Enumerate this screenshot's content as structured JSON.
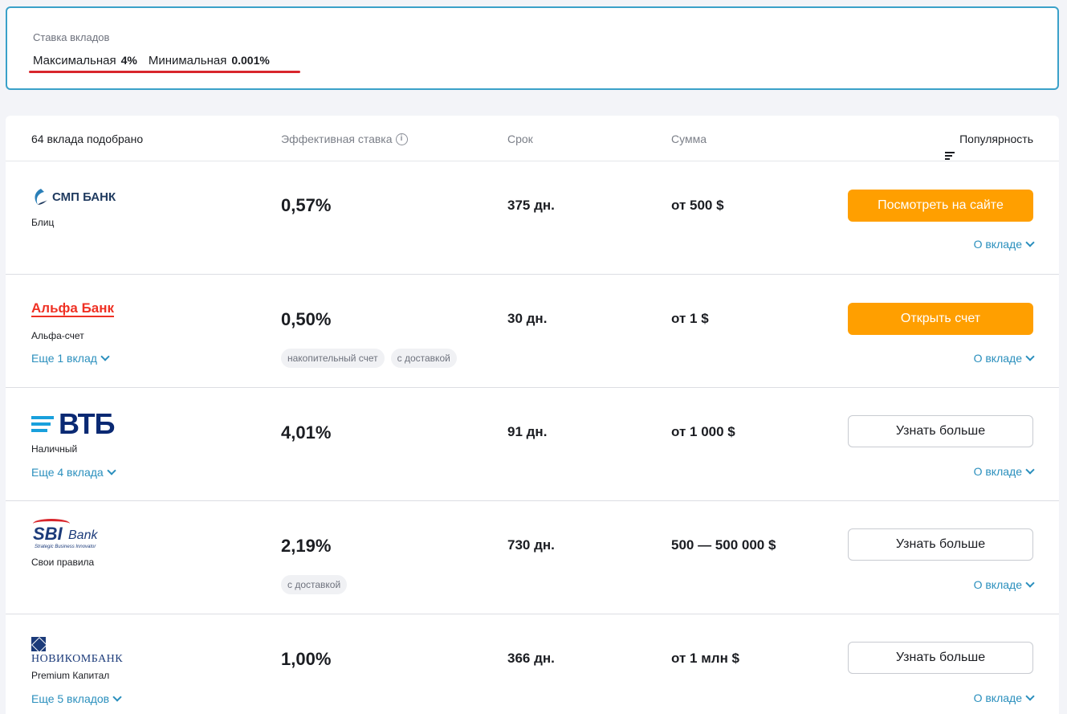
{
  "summary": {
    "caption": "Ставка вкладов",
    "max_label": "Максимальная",
    "max_value": "4%",
    "min_label": "Минимальная",
    "min_value": "0.001%",
    "underline_color": "#d8262c"
  },
  "header": {
    "count": "64 вклада подобрано",
    "rate": "Эффективная ставка",
    "term": "Срок",
    "sum": "Сумма",
    "sort": "Популярность"
  },
  "deals": [
    {
      "bank": "СМП БАНК",
      "product": "Блиц",
      "more": "",
      "rate": "0,57%",
      "term": "375 дн.",
      "sum": "от 500 $",
      "tags": [],
      "button": "Посмотреть на сайте",
      "button_style": "orange",
      "about": "О вкладе"
    },
    {
      "bank": "Альфа Банк",
      "product": "Альфа-счет",
      "more": "Еще 1 вклад",
      "rate": "0,50%",
      "term": "30 дн.",
      "sum": "от 1 $",
      "tags": [
        "накопительный счет",
        "с доставкой"
      ],
      "button": "Открыть счет",
      "button_style": "orange",
      "about": "О вкладе"
    },
    {
      "bank": "ВТБ",
      "product": "Наличный",
      "more": "Еще 4 вклада",
      "rate": "4,01%",
      "term": "91 дн.",
      "sum": "от 1 000 $",
      "tags": [],
      "button": "Узнать больше",
      "button_style": "white",
      "about": "О вкладе"
    },
    {
      "bank_sbi": "SBI",
      "bank_suffix": "Bank",
      "bank_tagline": "Strategic Business Innovator",
      "product": "Свои правила",
      "more": "",
      "rate": "2,19%",
      "term": "730 дн.",
      "sum": "500 — 500 000 $",
      "tags": [
        "с доставкой"
      ],
      "button": "Узнать больше",
      "button_style": "white",
      "about": "О вкладе"
    },
    {
      "bank": "НОВИКОМБАНК",
      "product": "Premium Капитал",
      "more": "Еще 5 вкладов",
      "rate": "1,00%",
      "term": "366 дн.",
      "sum": "от 1 млн $",
      "tags": [],
      "button": "Узнать больше",
      "button_style": "white",
      "about": "О вкладе"
    }
  ],
  "colors": {
    "accent_orange": "#ff9f00",
    "link_blue": "#2a8fbd",
    "summary_border": "#3aa1c9"
  }
}
